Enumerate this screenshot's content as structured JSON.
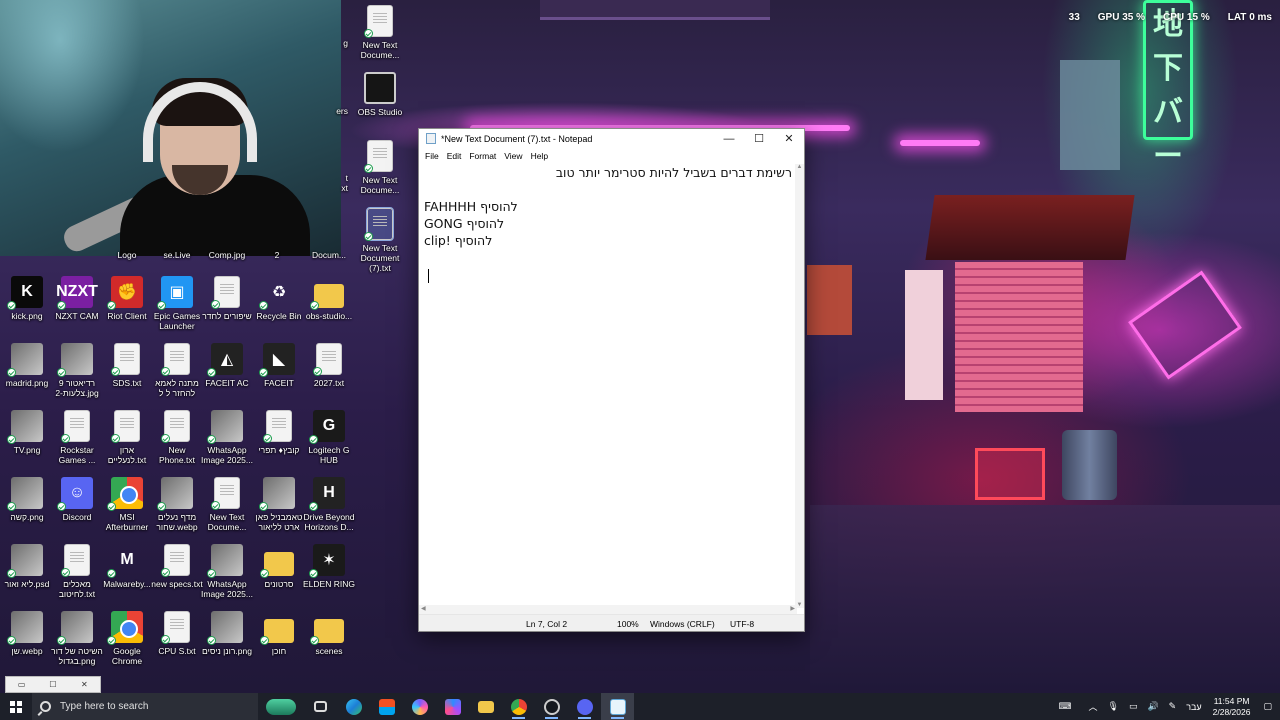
{
  "overlay": {
    "fps": "33",
    "gpu": "GPU 35 %",
    "cpu": "CPU 15 %",
    "lat": "LAT 0 ms"
  },
  "wallpaper": {
    "sign_text": "地下バー"
  },
  "notepad": {
    "title": "*New Text Document (7).txt - Notepad",
    "menu": [
      "File",
      "Edit",
      "Format",
      "View",
      "Help"
    ],
    "lines": [
      "רשימת דברים בשביל להיות סטרימר יותר טוב",
      "",
      "להוסיף FAHHHH",
      "להוסיף GONG",
      "להוסיף !clip",
      "",
      ""
    ],
    "status": {
      "position": "Ln 7, Col 2",
      "zoom": "100%",
      "line_endings": "Windows (CRLF)",
      "encoding": "UTF-8"
    },
    "window_buttons": {
      "minimize": "—",
      "maximize": "☐",
      "close": "✕"
    }
  },
  "desktop_icons": {
    "top_partial": [
      {
        "label": "Logo"
      },
      {
        "label": "se.Live"
      },
      {
        "label": "Comp.jpg"
      },
      {
        "label": "2"
      },
      {
        "label": "Docum..."
      }
    ],
    "column_right_top": [
      {
        "label": "New Text Docume..."
      },
      {
        "label": "OBS Studio"
      },
      {
        "label": "New Text Docume..."
      },
      {
        "label": "New Text Document (7).txt"
      }
    ],
    "left_edge_top": [
      {
        "label": "g"
      },
      {
        "label": "ers"
      },
      {
        "label": "t"
      },
      {
        "label": "xt"
      }
    ],
    "rows": [
      [
        {
          "label": "kick.png",
          "icon": "kick-icon"
        },
        {
          "label": "NZXT CAM",
          "icon": "nzxt-icon",
          "glyph": "NZXT"
        },
        {
          "label": "Riot Client",
          "icon": "riot-icon"
        },
        {
          "label": "Epic Games Launcher",
          "icon": "epic-icon"
        },
        {
          "label": "שיפורים לחדר",
          "icon": "text-file-icon"
        },
        {
          "label": "Recycle Bin",
          "icon": "recycle-bin-icon"
        },
        {
          "label": "obs-studio...",
          "icon": "folder-icon"
        }
      ],
      [
        {
          "label": "madrid.png",
          "icon": "image-icon"
        },
        {
          "label": "רדיאטור 9 צלעות-2.jpg",
          "icon": "image-icon"
        },
        {
          "label": "SDS.txt",
          "icon": "text-file-icon"
        },
        {
          "label": "מתנה לאמא להחזר ל ל",
          "icon": "text-file-icon"
        },
        {
          "label": "FACEIT AC",
          "icon": "faceit-ac-icon"
        },
        {
          "label": "FACEIT",
          "icon": "faceit-icon"
        },
        {
          "label": "2027.txt",
          "icon": "text-file-icon"
        }
      ],
      [
        {
          "label": "TV.png",
          "icon": "image-icon"
        },
        {
          "label": "Rockstar Games ...",
          "icon": "rockstar-icon"
        },
        {
          "label": "ארון לנעליים.txt",
          "icon": "text-file-icon"
        },
        {
          "label": "New Phone.txt",
          "icon": "text-file-icon"
        },
        {
          "label": "WhatsApp Image 2025...",
          "icon": "image-icon"
        },
        {
          "label": "קובץ♦ תפרי",
          "icon": "text-file-icon"
        },
        {
          "label": "Logitech G HUB",
          "icon": "logitech-icon"
        }
      ],
      [
        {
          "label": "קשה.png",
          "icon": "image-icon"
        },
        {
          "label": "Discord",
          "icon": "discord-icon"
        },
        {
          "label": "MSI Afterburner",
          "icon": "msi-icon"
        },
        {
          "label": "מדף נעלים שחור.webp",
          "icon": "image-icon"
        },
        {
          "label": "New Text Docume...",
          "icon": "text-file-icon"
        },
        {
          "label": "טאמבניל פאן ארט לליאור",
          "icon": "image-icon"
        },
        {
          "label": "Drive Beyond Horizons D...",
          "icon": "drive-beyond-icon"
        }
      ],
      [
        {
          "label": "ליא ואור.psd",
          "icon": "image-icon"
        },
        {
          "label": "מאכלים לחיטוב.txt",
          "icon": "text-file-icon"
        },
        {
          "label": "Malwareby...",
          "icon": "malwarebytes-icon"
        },
        {
          "label": "new specs.txt",
          "icon": "text-file-icon"
        },
        {
          "label": "WhatsApp Image 2025...",
          "icon": "image-icon"
        },
        {
          "label": "סרטונים",
          "icon": "folder-icon"
        },
        {
          "label": "ELDEN RING",
          "icon": "elden-ring-icon"
        }
      ],
      [
        {
          "label": "שן.webp",
          "icon": "image-icon"
        },
        {
          "label": "השיטה של דור בגדול.png",
          "icon": "image-icon"
        },
        {
          "label": "Google Chrome",
          "icon": "chrome-icon"
        },
        {
          "label": "CPU S.txt",
          "icon": "text-file-icon"
        },
        {
          "label": "רונן ניסים.png",
          "icon": "image-icon"
        },
        {
          "label": "חוכן",
          "icon": "folder-icon"
        },
        {
          "label": "scenes",
          "icon": "folder-icon"
        }
      ]
    ]
  },
  "taskbar": {
    "search_placeholder": "Type here to search",
    "apps": [
      "task-view",
      "edge",
      "store",
      "copilot",
      "photos",
      "file-explorer",
      "chrome",
      "steam",
      "discord",
      "notepad"
    ],
    "tray": {
      "lang": "עבר",
      "time": "11:54 PM",
      "date": "2/28/2026"
    }
  },
  "colors": {
    "taskbar": "#1d2029",
    "accent": "#7fb6ff"
  }
}
